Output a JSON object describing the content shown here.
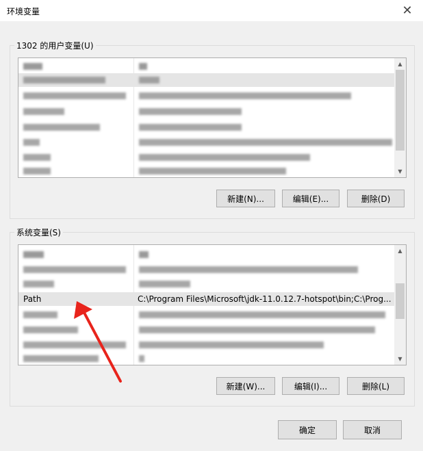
{
  "window": {
    "title": "环境变量"
  },
  "user_group": {
    "legend": "1302 的用户变量(U)",
    "buttons": {
      "new": "新建(N)...",
      "edit": "编辑(E)...",
      "delete": "删除(D)"
    }
  },
  "system_group": {
    "legend": "系统变量(S)",
    "path_row": {
      "name": "Path",
      "value": "C:\\Program Files\\Microsoft\\jdk-11.0.12.7-hotspot\\bin;C:\\Prog..."
    },
    "buttons": {
      "new": "新建(W)...",
      "edit": "编辑(I)...",
      "delete": "删除(L)"
    }
  },
  "footer": {
    "ok": "确定",
    "cancel": "取消"
  },
  "annotation": {
    "arrow_color": "#e8241c"
  }
}
